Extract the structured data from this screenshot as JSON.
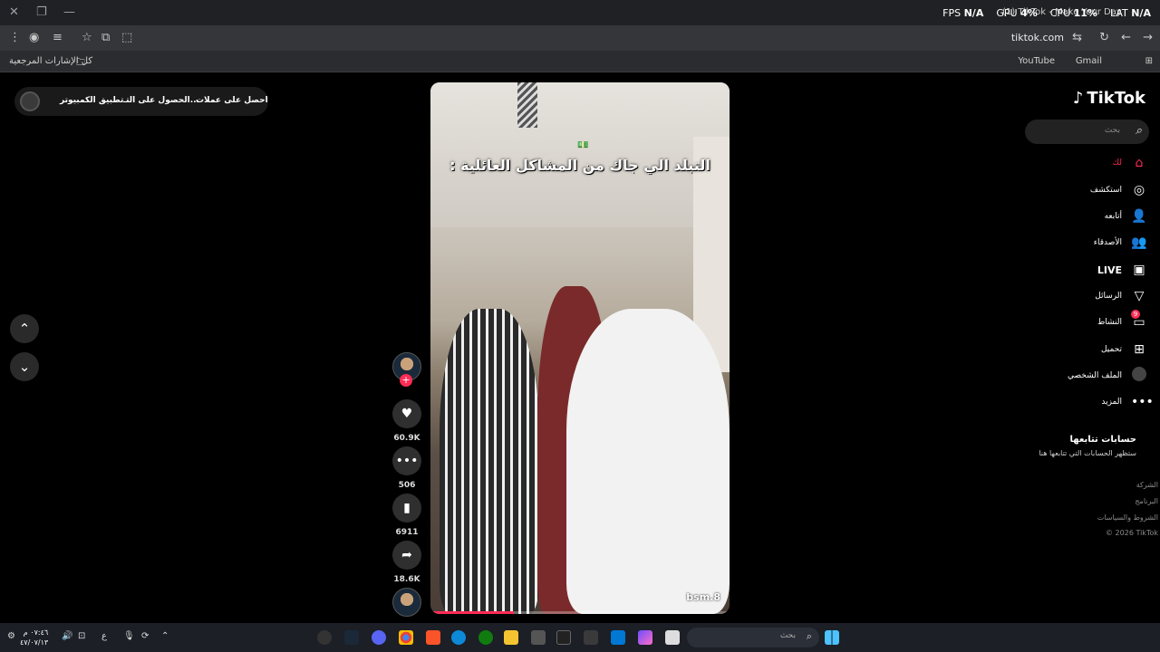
{
  "window": {
    "tab_title": "(1) TikTok - Make Your Day",
    "overlay": {
      "fps_label": "FPS",
      "fps_value": "N/A",
      "gpu_label": "GPU",
      "gpu_value": "4%",
      "cpu_label": "CPU",
      "cpu_value": "11%",
      "lat_label": "LAT",
      "lat_value": "N/A"
    }
  },
  "browser": {
    "url": "tiktok.com",
    "bookmarks_folder": "كل الإشارات المرجعية",
    "bookmarks": [
      "YouTube",
      "Gmail"
    ]
  },
  "promo": {
    "coins": "احصل على عملات",
    "app": "الحصول على التـ...",
    "desktop": "تطبيق الكمبيوتر"
  },
  "video": {
    "caption": "التبلد الي جاك من المشاكل العائلية :",
    "author": "bsm.8",
    "progress": 0.28
  },
  "actions": {
    "likes": "60.9K",
    "comments": "506",
    "saves": "6911",
    "shares": "18.6K"
  },
  "sidebar": {
    "logo": "TikTok",
    "search_placeholder": "بحث",
    "menu": [
      {
        "label": "لك",
        "icon": "home-icon"
      },
      {
        "label": "استكشف",
        "icon": "compass-icon"
      },
      {
        "label": "أتابعه",
        "icon": "user-plus-icon"
      },
      {
        "label": "الأصدقاء",
        "icon": "friends-icon"
      },
      {
        "label": "LIVE",
        "icon": "live-icon"
      },
      {
        "label": "الرسائل",
        "icon": "send-icon"
      },
      {
        "label": "النشاط",
        "icon": "activity-icon",
        "badge": "9"
      },
      {
        "label": "تحميل",
        "icon": "upload-icon"
      },
      {
        "label": "الملف الشخصي",
        "icon": "profile-avatar"
      },
      {
        "label": "المزيد",
        "icon": "more-icon"
      }
    ],
    "following_title": "حسابات تتابعها",
    "following_sub": "ستظهر الحسابات التي تتابعها هنا",
    "footer": [
      "الشركة",
      "البرنامج",
      "الشروط والسياسات",
      "© 2026 TikTok"
    ]
  },
  "taskbar": {
    "search_placeholder": "بحث",
    "time": "٠٧:٤٦ م",
    "date": "٤٧/٠٧/١٣",
    "lang": "ع"
  }
}
